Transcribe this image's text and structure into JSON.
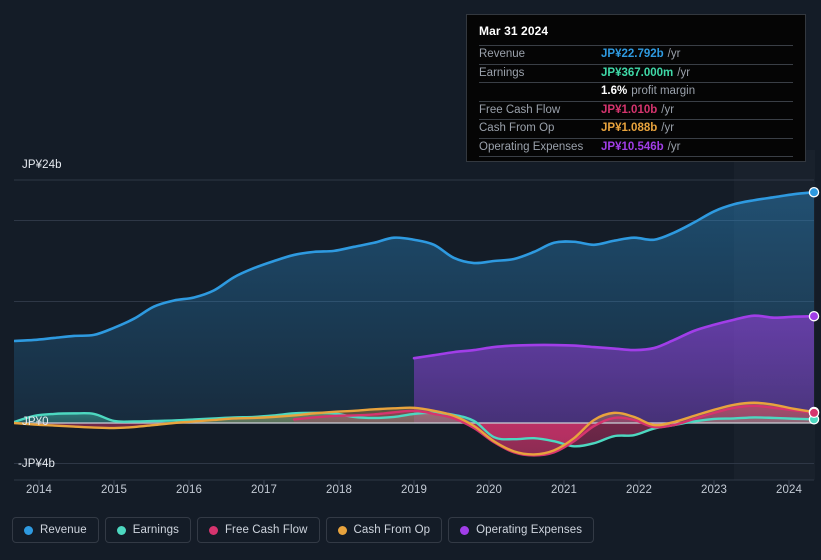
{
  "chart_data": {
    "type": "area",
    "title": "",
    "xlabel": "",
    "ylabel": "",
    "currency": "JP¥",
    "grid": true,
    "legend_position": "bottom",
    "ylim": [
      -4,
      24
    ],
    "y_ticks": [
      {
        "value": 24,
        "label": "JP¥24b"
      },
      {
        "value": 0,
        "label": "JP¥0"
      },
      {
        "value": -4,
        "label": "-JP¥4b"
      }
    ],
    "y_gridlines": [
      24,
      20,
      12,
      0,
      -4
    ],
    "x": [
      2014,
      2015,
      2016,
      2017,
      2018,
      2019,
      2020,
      2021,
      2022,
      2023,
      2024
    ],
    "x_tick_labels": [
      "2014",
      "2015",
      "2016",
      "2017",
      "2018",
      "2019",
      "2020",
      "2021",
      "2022",
      "2023",
      "2024"
    ],
    "series": [
      {
        "name": "Revenue",
        "color": "#2e9ae0",
        "values": [
          8.1,
          8.2,
          8.4,
          8.6,
          8.7,
          9.4,
          10.3,
          11.5,
          12.1,
          12.4,
          13.1,
          14.4,
          15.3,
          16.0,
          16.6,
          16.9,
          17.0,
          17.4,
          17.8,
          18.3,
          18.1,
          17.6,
          16.3,
          15.8,
          16.0,
          16.2,
          16.9,
          17.8,
          17.9,
          17.6,
          18.0,
          18.3,
          18.1,
          18.8,
          19.8,
          20.9,
          21.6,
          22.0,
          22.3,
          22.6,
          22.792
        ],
        "final_value": 22.792,
        "final_label": "JP¥22.792b"
      },
      {
        "name": "Earnings",
        "color": "#4dd8c0",
        "values": [
          0.1,
          0.7,
          0.9,
          0.95,
          0.9,
          0.2,
          0.15,
          0.2,
          0.25,
          0.35,
          0.45,
          0.55,
          0.6,
          0.75,
          0.95,
          1.0,
          0.95,
          0.6,
          0.5,
          0.6,
          0.9,
          1.0,
          0.8,
          0.2,
          -1.4,
          -1.6,
          -1.5,
          -1.8,
          -2.3,
          -2.0,
          -1.3,
          -1.2,
          -0.55,
          -0.2,
          0.15,
          0.4,
          0.45,
          0.55,
          0.5,
          0.42,
          0.367
        ],
        "final_value": 0.367,
        "final_label": "JP¥367.000m"
      },
      {
        "name": "Free Cash Flow",
        "color": "#d6346e",
        "values": [
          null,
          null,
          null,
          null,
          null,
          null,
          null,
          null,
          null,
          null,
          null,
          null,
          null,
          null,
          0.35,
          0.55,
          0.7,
          0.75,
          0.85,
          1.05,
          1.2,
          0.9,
          0.45,
          -0.5,
          -1.9,
          -2.9,
          -3.2,
          -2.9,
          -1.8,
          -0.3,
          0.5,
          0.3,
          -0.4,
          -0.2,
          0.4,
          1.0,
          1.5,
          1.7,
          1.5,
          1.25,
          1.01
        ],
        "final_value": 1.01,
        "final_label": "JP¥1.010b"
      },
      {
        "name": "Cash From Op",
        "color": "#e8a33d",
        "values": [
          0.0,
          -0.15,
          -0.25,
          -0.35,
          -0.45,
          -0.5,
          -0.4,
          -0.2,
          0.0,
          0.15,
          0.3,
          0.45,
          0.5,
          0.6,
          0.75,
          0.95,
          1.1,
          1.2,
          1.35,
          1.45,
          1.5,
          1.2,
          0.7,
          -0.3,
          -1.8,
          -2.8,
          -3.1,
          -2.7,
          -1.5,
          0.3,
          1.0,
          0.6,
          -0.2,
          0.1,
          0.7,
          1.3,
          1.8,
          2.0,
          1.8,
          1.4,
          1.088
        ],
        "final_value": 1.088,
        "final_label": "JP¥1.088b"
      },
      {
        "name": "Operating Expenses",
        "color": "#a13ee8",
        "starts_at_x": 2019.0,
        "values": [
          null,
          null,
          null,
          null,
          null,
          null,
          null,
          null,
          null,
          null,
          null,
          null,
          null,
          null,
          null,
          null,
          null,
          null,
          null,
          null,
          6.4,
          6.7,
          7.0,
          7.2,
          7.5,
          7.65,
          7.7,
          7.7,
          7.65,
          7.5,
          7.35,
          7.2,
          7.4,
          8.2,
          9.1,
          9.7,
          10.2,
          10.6,
          10.4,
          10.5,
          10.546
        ],
        "final_value": 10.546,
        "final_label": "JP¥10.546b"
      }
    ]
  },
  "yaxis": {
    "top_label": "JP¥24b",
    "zero_label": "JP¥0",
    "bottom_label": "-JP¥4b"
  },
  "xaxis": {
    "ticks": [
      "2014",
      "2015",
      "2016",
      "2017",
      "2018",
      "2019",
      "2020",
      "2021",
      "2022",
      "2023",
      "2024"
    ]
  },
  "tooltip": {
    "date": "Mar 31 2024",
    "rows": [
      {
        "name": "Revenue",
        "value": "JP¥22.792b",
        "unit": "/yr",
        "color": "#2e9ae0"
      },
      {
        "name": "Earnings",
        "value": "JP¥367.000m",
        "unit": "/yr",
        "color": "#3fd9a8"
      },
      {
        "name": "",
        "value": "1.6%",
        "unit": "profit margin",
        "color": "#ffffff"
      },
      {
        "name": "Free Cash Flow",
        "value": "JP¥1.010b",
        "unit": "/yr",
        "color": "#d6346e"
      },
      {
        "name": "Cash From Op",
        "value": "JP¥1.088b",
        "unit": "/yr",
        "color": "#e8a33d"
      },
      {
        "name": "Operating Expenses",
        "value": "JP¥10.546b",
        "unit": "/yr",
        "color": "#a13ee8"
      }
    ]
  },
  "legend": {
    "items": [
      {
        "label": "Revenue",
        "color": "#2e9ae0"
      },
      {
        "label": "Earnings",
        "color": "#4dd8c0"
      },
      {
        "label": "Free Cash Flow",
        "color": "#d6346e"
      },
      {
        "label": "Cash From Op",
        "color": "#e8a33d"
      },
      {
        "label": "Operating Expenses",
        "color": "#a13ee8"
      }
    ]
  },
  "theme": {
    "background": "#141c27",
    "gridline": "#2e3746",
    "zero_line": "#c9ced6",
    "tooltip_bg": "#050505",
    "tooltip_border": "#33383f"
  }
}
